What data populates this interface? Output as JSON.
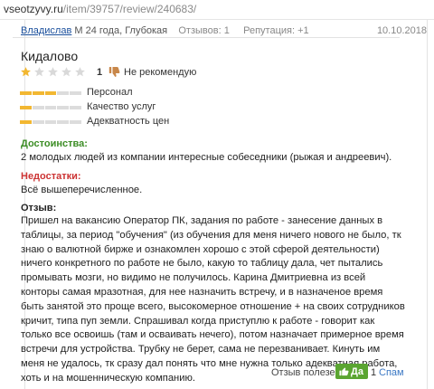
{
  "browser": {
    "url_host": "vseotzyvy.ru",
    "url_path": "/item/39757/review/240683/"
  },
  "review": {
    "author": "Владислав",
    "author_info": "М 24 года, Глубокая",
    "reviews_count": "Отзывов: 1",
    "reputation": "Репутация: +1",
    "date": "10.10.2018",
    "title": "Кидалово",
    "rating": 1,
    "rating_max": 5,
    "votes": "1",
    "verdict": "Не рекомендую",
    "colors": {
      "star_on": "#f2b731",
      "star_off": "#d9d9d9",
      "pros": "#3c8d25",
      "cons": "#cc3333",
      "yes": "#5aa531"
    },
    "criteria": [
      {
        "label": "Персонал",
        "score": 3,
        "max": 5
      },
      {
        "label": "Качество услуг",
        "score": 1,
        "max": 5
      },
      {
        "label": "Адекватность цен",
        "score": 1,
        "max": 5
      }
    ],
    "pros_title": "Достоинства:",
    "pros_text": "2 молодых людей из компании интересные собеседники (рыжая и андреевич).",
    "cons_title": "Недостатки:",
    "cons_text": "Всё вышеперечисленное.",
    "body_title": "Отзыв:",
    "body_text": "Пришел на вакансию Оператор ПК, задания по работе - занесение данных в таблицы, за период \"обучения\" (из обучения для меня ничего нового не было, тк знаю о валютной бирже и ознакомлен хорошо с этой сферой деятельности) ничего конкретного по работе не было, какую то таблицу дала, чет пытались промывать мозги, но видимо не получилось. Карина Дмитриевна из всей конторы самая мразотная, для нее назначить встречу, и в назначеное время быть занятой это проще всего, высокомерное отношение + на своих сотрудников кричит, типа пуп земли. Спрашивал когда приступлю к работе - говорит как только все освоишь (там и осваивать нечего), потом назначает примерное время встречи для устройства. Трубку не берет, сама не перезванивает. Кинуть им меня не удалось, тк сразу дал понять что мне нужна только адекватная работа, хоть и на мошенническую компанию.",
    "helpful_question": "Отзыв полезен?",
    "yes_label": "Да",
    "yes_count": "1",
    "spam_label": "Спам"
  }
}
